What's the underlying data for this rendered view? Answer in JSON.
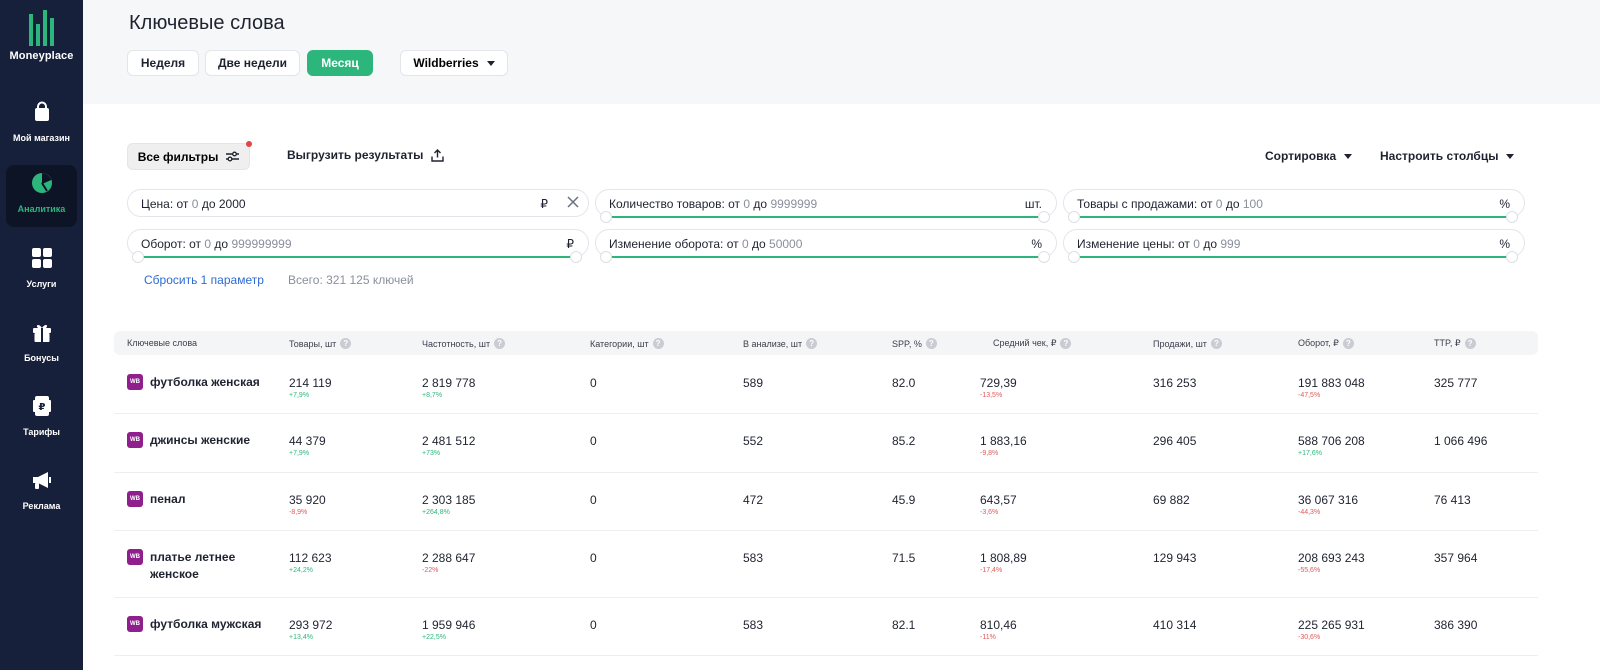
{
  "brand": {
    "name": "Moneyplace"
  },
  "sidebar": {
    "items": [
      {
        "label": "Мой магазин",
        "icon": "shopping-bag-icon",
        "active": false
      },
      {
        "label": "Аналитика",
        "icon": "pie-chart-icon",
        "active": true
      },
      {
        "label": "Услуги",
        "icon": "grid-icon",
        "active": false
      },
      {
        "label": "Бонусы",
        "icon": "gift-icon",
        "active": false
      },
      {
        "label": "Тарифы",
        "icon": "tariff-card-icon",
        "active": false
      },
      {
        "label": "Реклама",
        "icon": "megaphone-icon",
        "active": false
      }
    ]
  },
  "header": {
    "title": "Ключевые слова",
    "periods": [
      "Неделя",
      "Две недели",
      "Месяц"
    ],
    "active_period": "Месяц",
    "marketplace": "Wildberries"
  },
  "toolbar": {
    "filters_label": "Все фильтры",
    "export_label": "Выгрузить результаты",
    "sort_label": "Сортировка",
    "columns_label": "Настроить столбцы"
  },
  "filters": {
    "price": {
      "label": "Цена: от",
      "from": "0",
      "to_label": "до",
      "to": "2000",
      "unit": "₽"
    },
    "goods_count": {
      "label": "Количество товаров: от",
      "from": "0",
      "to_label": "до",
      "to": "9999999",
      "unit": "шт."
    },
    "goods_with_sales": {
      "label": "Товары с продажами: от",
      "from": "0",
      "to_label": "до",
      "to": "100",
      "unit": "%"
    },
    "turnover": {
      "label": "Оборот: от",
      "from": "0",
      "to_label": "до",
      "to": "999999999",
      "unit": "₽"
    },
    "turnover_change": {
      "label": "Изменение оборота: от",
      "from": "0",
      "to_label": "до",
      "to": "50000",
      "unit": "%"
    },
    "price_change": {
      "label": "Изменение цены: от",
      "from": "0",
      "to_label": "до",
      "to": "999",
      "unit": "%"
    },
    "reset_label": "Сбросить 1 параметр",
    "total_label": "Всего: 321 125 ключей"
  },
  "table": {
    "columns": [
      "Ключевые слова",
      "Товары, шт",
      "Частотность, шт",
      "Категории, шт",
      "В анализе, шт",
      "SPP, %",
      "Средний чек, ₽",
      "Продажи, шт",
      "Оборот, ₽",
      "TTP, ₽"
    ],
    "badge": "WB",
    "rows": [
      {
        "keyword": "футболка женская",
        "goods": "214 119",
        "goods_delta": "+7,9%",
        "frequency": "2 819 778",
        "frequency_delta": "+8,7%",
        "categories": "0",
        "in_analysis": "589",
        "spp": "82.0",
        "avg_check": "729,39",
        "avg_check_delta": "-13,5%",
        "sales": "316 253",
        "turnover": "191 883 048",
        "turnover_delta": "-47,5%",
        "ttp": "325 777"
      },
      {
        "keyword": "джинсы женские",
        "goods": "44 379",
        "goods_delta": "+7,9%",
        "frequency": "2 481 512",
        "frequency_delta": "+73%",
        "categories": "0",
        "in_analysis": "552",
        "spp": "85.2",
        "avg_check": "1 883,16",
        "avg_check_delta": "-9,8%",
        "sales": "296 405",
        "turnover": "588 706 208",
        "turnover_delta": "+17,6%",
        "ttp": "1 066 496"
      },
      {
        "keyword": "пенал",
        "goods": "35 920",
        "goods_delta": "-8,9%",
        "frequency": "2 303 185",
        "frequency_delta": "+264,8%",
        "categories": "0",
        "in_analysis": "472",
        "spp": "45.9",
        "avg_check": "643,57",
        "avg_check_delta": "-3,6%",
        "sales": "69 882",
        "turnover": "36 067 316",
        "turnover_delta": "-44,3%",
        "ttp": "76 413"
      },
      {
        "keyword": "платье летнее женское",
        "goods": "112 623",
        "goods_delta": "+24,2%",
        "frequency": "2 288 647",
        "frequency_delta": "-22%",
        "categories": "0",
        "in_analysis": "583",
        "spp": "71.5",
        "avg_check": "1 808,89",
        "avg_check_delta": "-17,4%",
        "sales": "129 943",
        "turnover": "208 693 243",
        "turnover_delta": "-55,6%",
        "ttp": "357 964"
      },
      {
        "keyword": "футболка мужская",
        "goods": "293 972",
        "goods_delta": "+13,4%",
        "frequency": "1 959 946",
        "frequency_delta": "+22,5%",
        "categories": "0",
        "in_analysis": "583",
        "spp": "82.1",
        "avg_check": "810,46",
        "avg_check_delta": "-11%",
        "sales": "410 314",
        "turnover": "225 265 931",
        "turnover_delta": "-30,6%",
        "ttp": "386 390"
      }
    ]
  },
  "colors": {
    "accent": "#2db67c",
    "sidebar": "#17203a",
    "negative": "#e05a5a",
    "link": "#2d6bd4",
    "wb_badge": "#8e1f8c"
  }
}
